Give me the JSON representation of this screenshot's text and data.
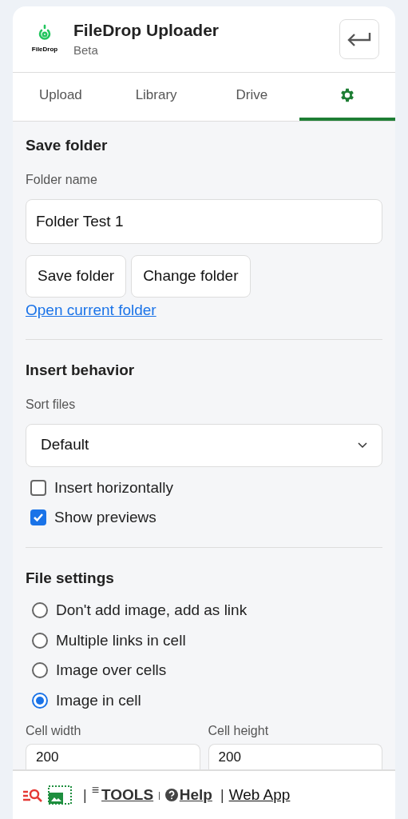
{
  "header": {
    "logo_text": "FileDrop",
    "title": "FileDrop Uploader",
    "subtitle": "Beta"
  },
  "tabs": [
    {
      "label": "Upload",
      "kind": "text",
      "selected": false
    },
    {
      "label": "Library",
      "kind": "text",
      "selected": false
    },
    {
      "label": "Drive",
      "kind": "text",
      "selected": false
    },
    {
      "kind": "gear",
      "selected": true
    }
  ],
  "save_folder": {
    "heading": "Save folder",
    "field_label": "Folder name",
    "value": "Folder Test 1",
    "buttons": [
      "Save folder",
      "Change folder"
    ],
    "link": "Open current folder"
  },
  "insert_behavior": {
    "heading": "Insert behavior",
    "sort_label": "Sort files",
    "sort_value": "Default",
    "checkboxes": [
      {
        "label": "Insert horizontally",
        "checked": false
      },
      {
        "label": "Show previews",
        "checked": true
      }
    ]
  },
  "file_settings": {
    "heading": "File settings",
    "options": [
      {
        "label": "Don't add image, add as link",
        "selected": false
      },
      {
        "label": "Multiple links in cell",
        "selected": false
      },
      {
        "label": "Image over cells",
        "selected": false
      },
      {
        "label": "Image in cell",
        "selected": true
      }
    ],
    "fields": [
      {
        "label": "Cell width",
        "value": "200"
      },
      {
        "label": "Cell height",
        "value": "200"
      }
    ]
  },
  "footer": {
    "separators": [
      "|",
      "|",
      "|"
    ],
    "tools_icon": "≡",
    "tools": "TOOLS",
    "help": "Help",
    "web_app": "Web App"
  }
}
